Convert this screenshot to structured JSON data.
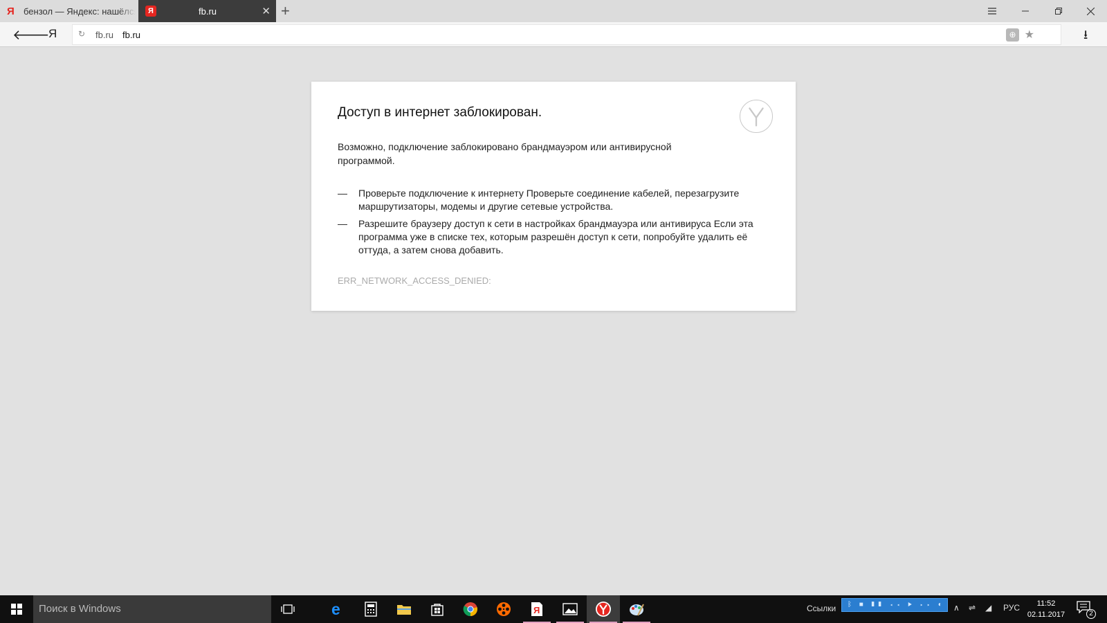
{
  "browser": {
    "tabs": [
      {
        "title": "бензол — Яндекс: нашёлся",
        "favicon": "yandex-logo-icon",
        "active": false
      },
      {
        "title": "fb.ru",
        "favicon": "fb-site-icon",
        "active": true
      }
    ],
    "new_tab_symbol": "+",
    "address": {
      "host_hint": "fb.ru",
      "url": "fb.ru"
    }
  },
  "error": {
    "title": "Доступ в интернет заблокирован.",
    "description": "Возможно, подключение заблокировано брандмауэром или антивирусной программой.",
    "dash": "—",
    "suggestions": [
      "Проверьте подключение к интернету Проверьте соединение кабелей, перезагрузите маршрутизаторы, модемы и другие сетевые устройства.",
      "Разрешите браузеру доступ к сети в настройках брандмауэра или антивируса Если эта программа уже в списке тех, которым разрешён доступ к сети, попробуйте удалить её оттуда, а затем снова добавить."
    ],
    "code": "ERR_NETWORK_ACCESS_DENIED:"
  },
  "taskbar": {
    "search_placeholder": "Поиск в Windows",
    "links_label": "Ссылки",
    "language": "РУС",
    "time": "11:52",
    "date": "02.11.2017",
    "notification_count": "2",
    "media_controls": "ᛒ ■ ❚❚ ◂◂ ▶ ▸▸ ◐ ▾"
  },
  "colors": {
    "accent_red": "#e52620",
    "tab_active_bg": "#3c3c3c",
    "page_bg": "#e1e1e1",
    "taskbar_bg": "#101010",
    "media_bar": "#2b7ed0"
  }
}
